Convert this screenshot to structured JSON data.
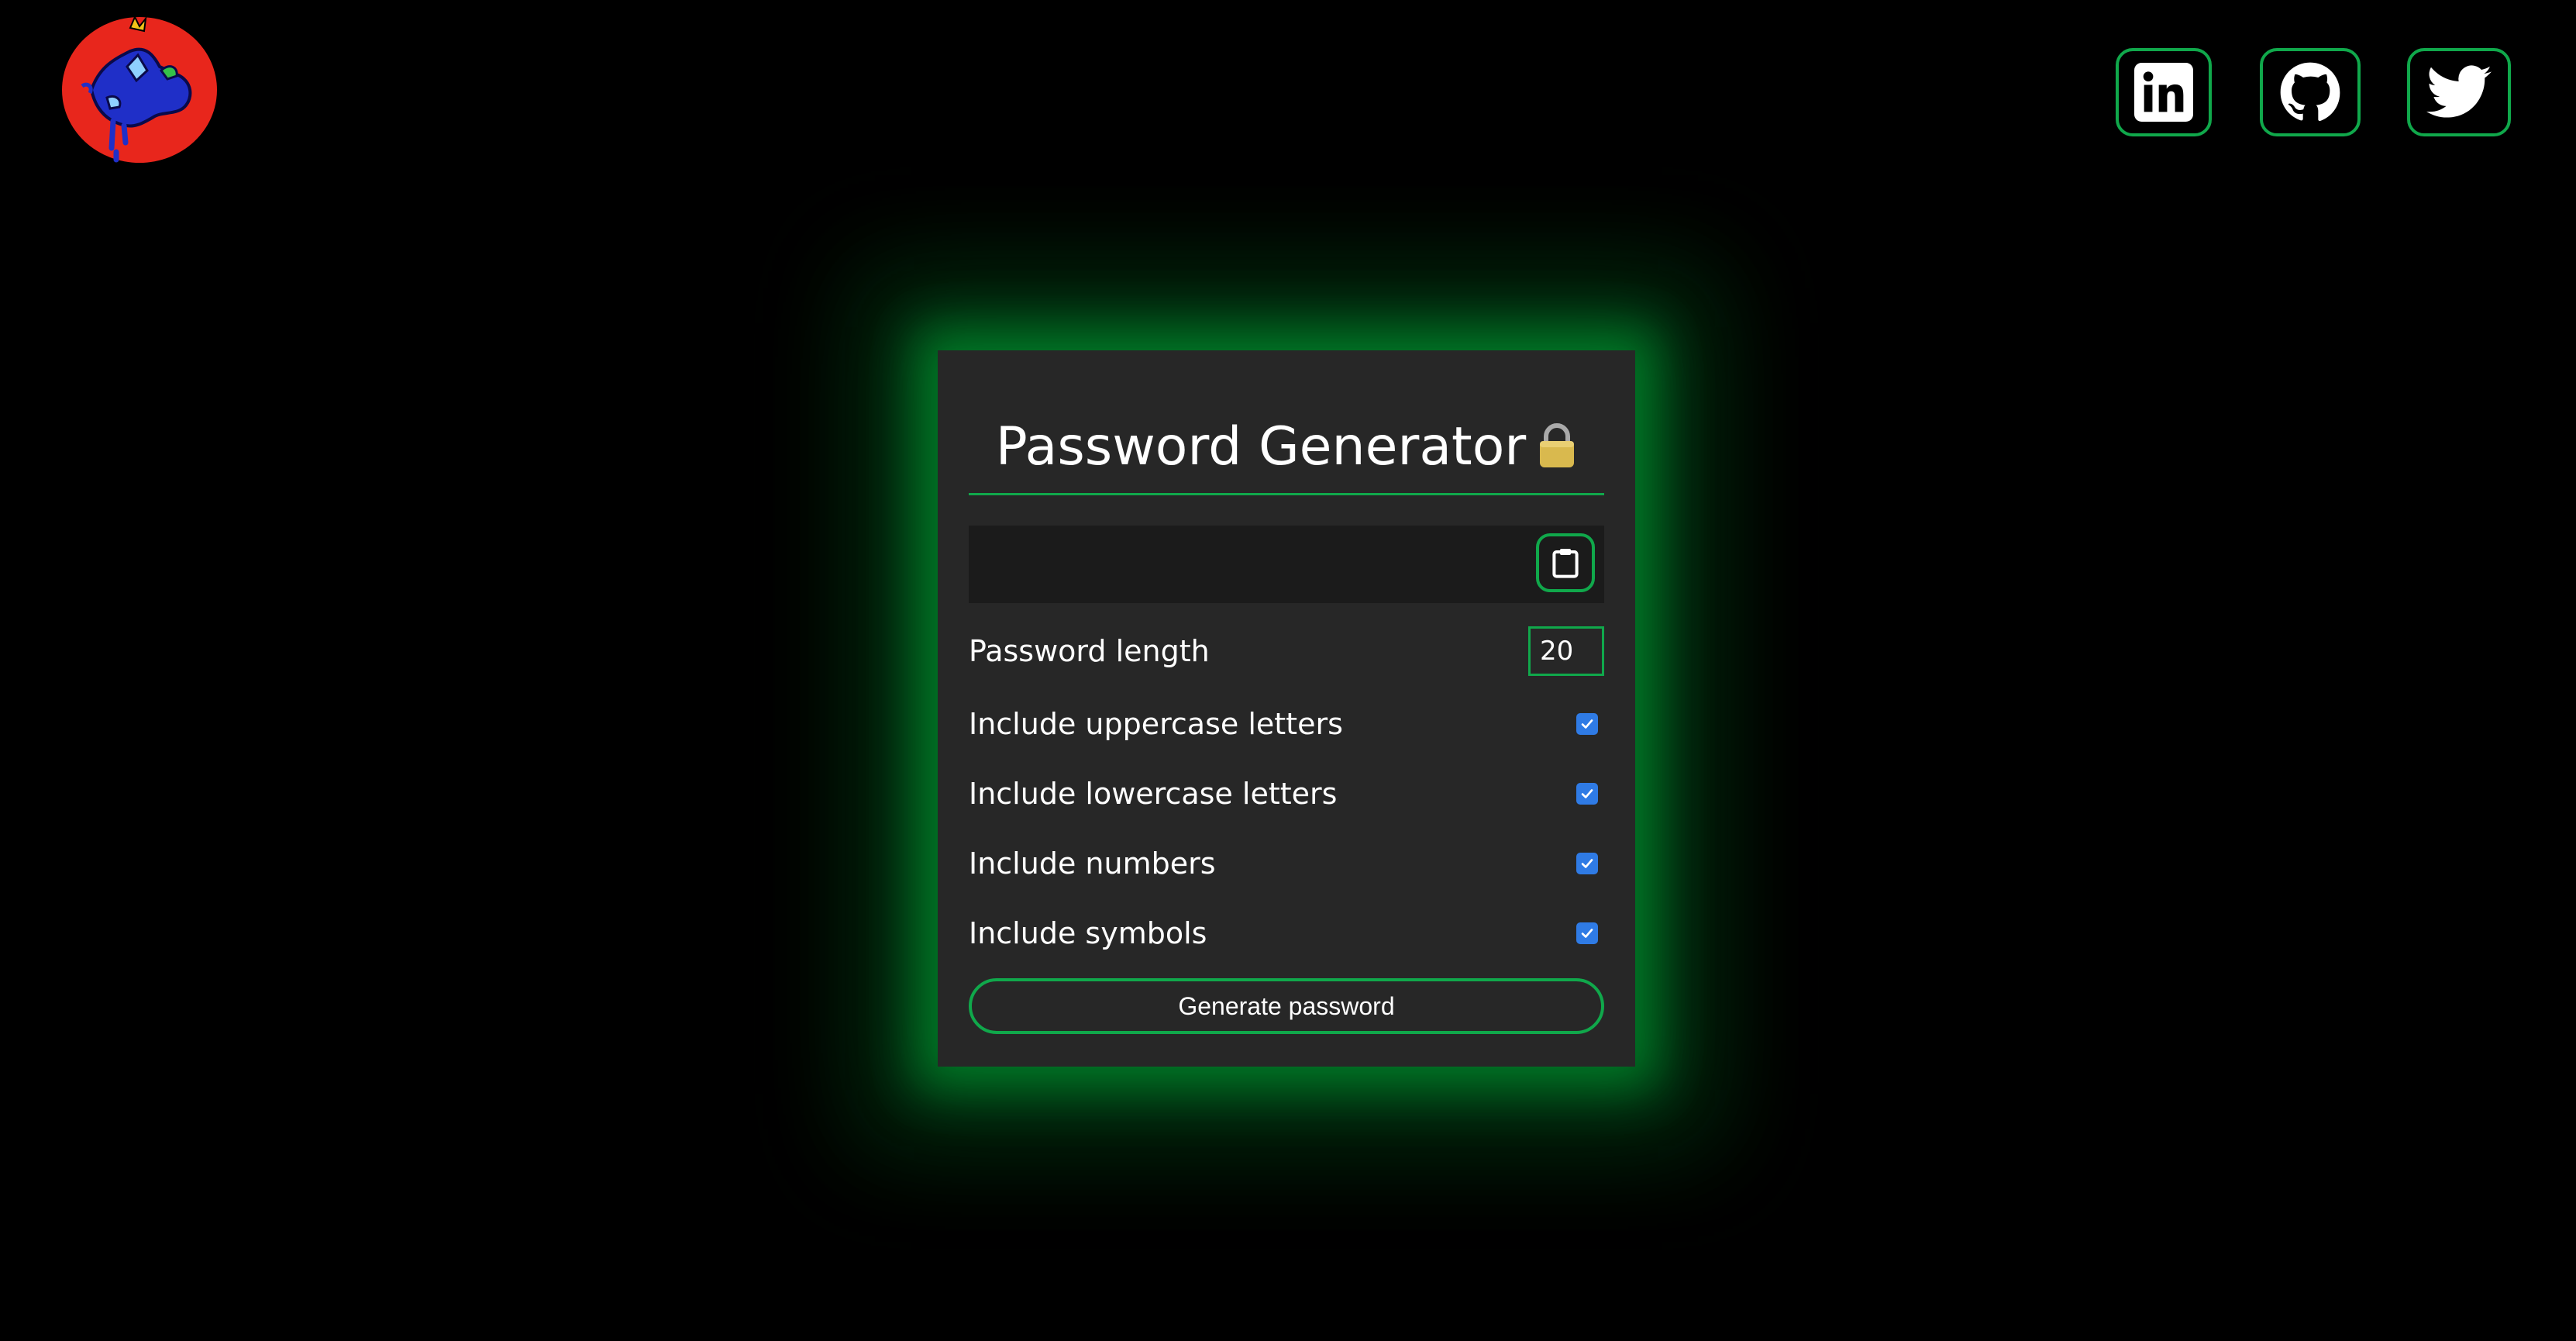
{
  "header": {
    "logo_alt": "logo",
    "social_links": [
      {
        "name": "LinkedIn",
        "icon": "linkedin-icon"
      },
      {
        "name": "GitHub",
        "icon": "github-icon"
      },
      {
        "name": "Twitter",
        "icon": "twitter-icon"
      }
    ]
  },
  "generator": {
    "title": "Password Generator",
    "title_icon": "lock-icon",
    "password_value": "",
    "copy_icon": "clipboard-icon",
    "length_label": "Password length",
    "length_value": "20",
    "options": [
      {
        "label": "Include uppercase letters",
        "checked": true
      },
      {
        "label": "Include lowercase letters",
        "checked": true
      },
      {
        "label": "Include numbers",
        "checked": true
      },
      {
        "label": "Include symbols",
        "checked": true
      }
    ],
    "generate_label": "Generate password"
  },
  "colors": {
    "background": "#000000",
    "card": "#272727",
    "accent": "#10a84b",
    "checkbox": "#2f7be5",
    "output_field": "#1b1b1b"
  }
}
